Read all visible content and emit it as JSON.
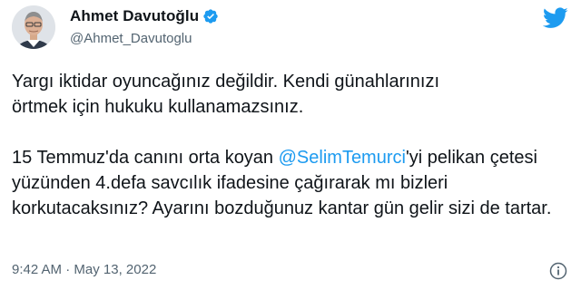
{
  "author": {
    "display_name": "Ahmet Davutoğlu",
    "handle": "@Ahmet_Davutoglu",
    "verified": true
  },
  "tweet": {
    "paragraph1_line1": "Yargı iktidar oyuncağınız değildir. Kendi günahlarınızı",
    "paragraph1_line2": "örtmek için hukuku kullanamazsınız.",
    "paragraph2_before_mention": "15 Temmuz'da canını orta koyan ",
    "mention": "@SelimTemurci",
    "paragraph2_after_mention": "'yi pelikan çetesi yüzünden 4.defa savcılık ifadesine çağırarak mı bizleri korkutacaksınız? Ayarını bozduğunuz kantar gün gelir sizi de tartar."
  },
  "meta": {
    "time": "9:42 AM",
    "separator": " · ",
    "date": "May 13, 2022"
  },
  "icons": {
    "verified": "verified-badge-icon",
    "brand": "twitter-bird-icon",
    "info": "info-icon"
  },
  "colors": {
    "brand_blue": "#1d9bf0",
    "text_primary": "#0f1419",
    "text_secondary": "#536471"
  }
}
